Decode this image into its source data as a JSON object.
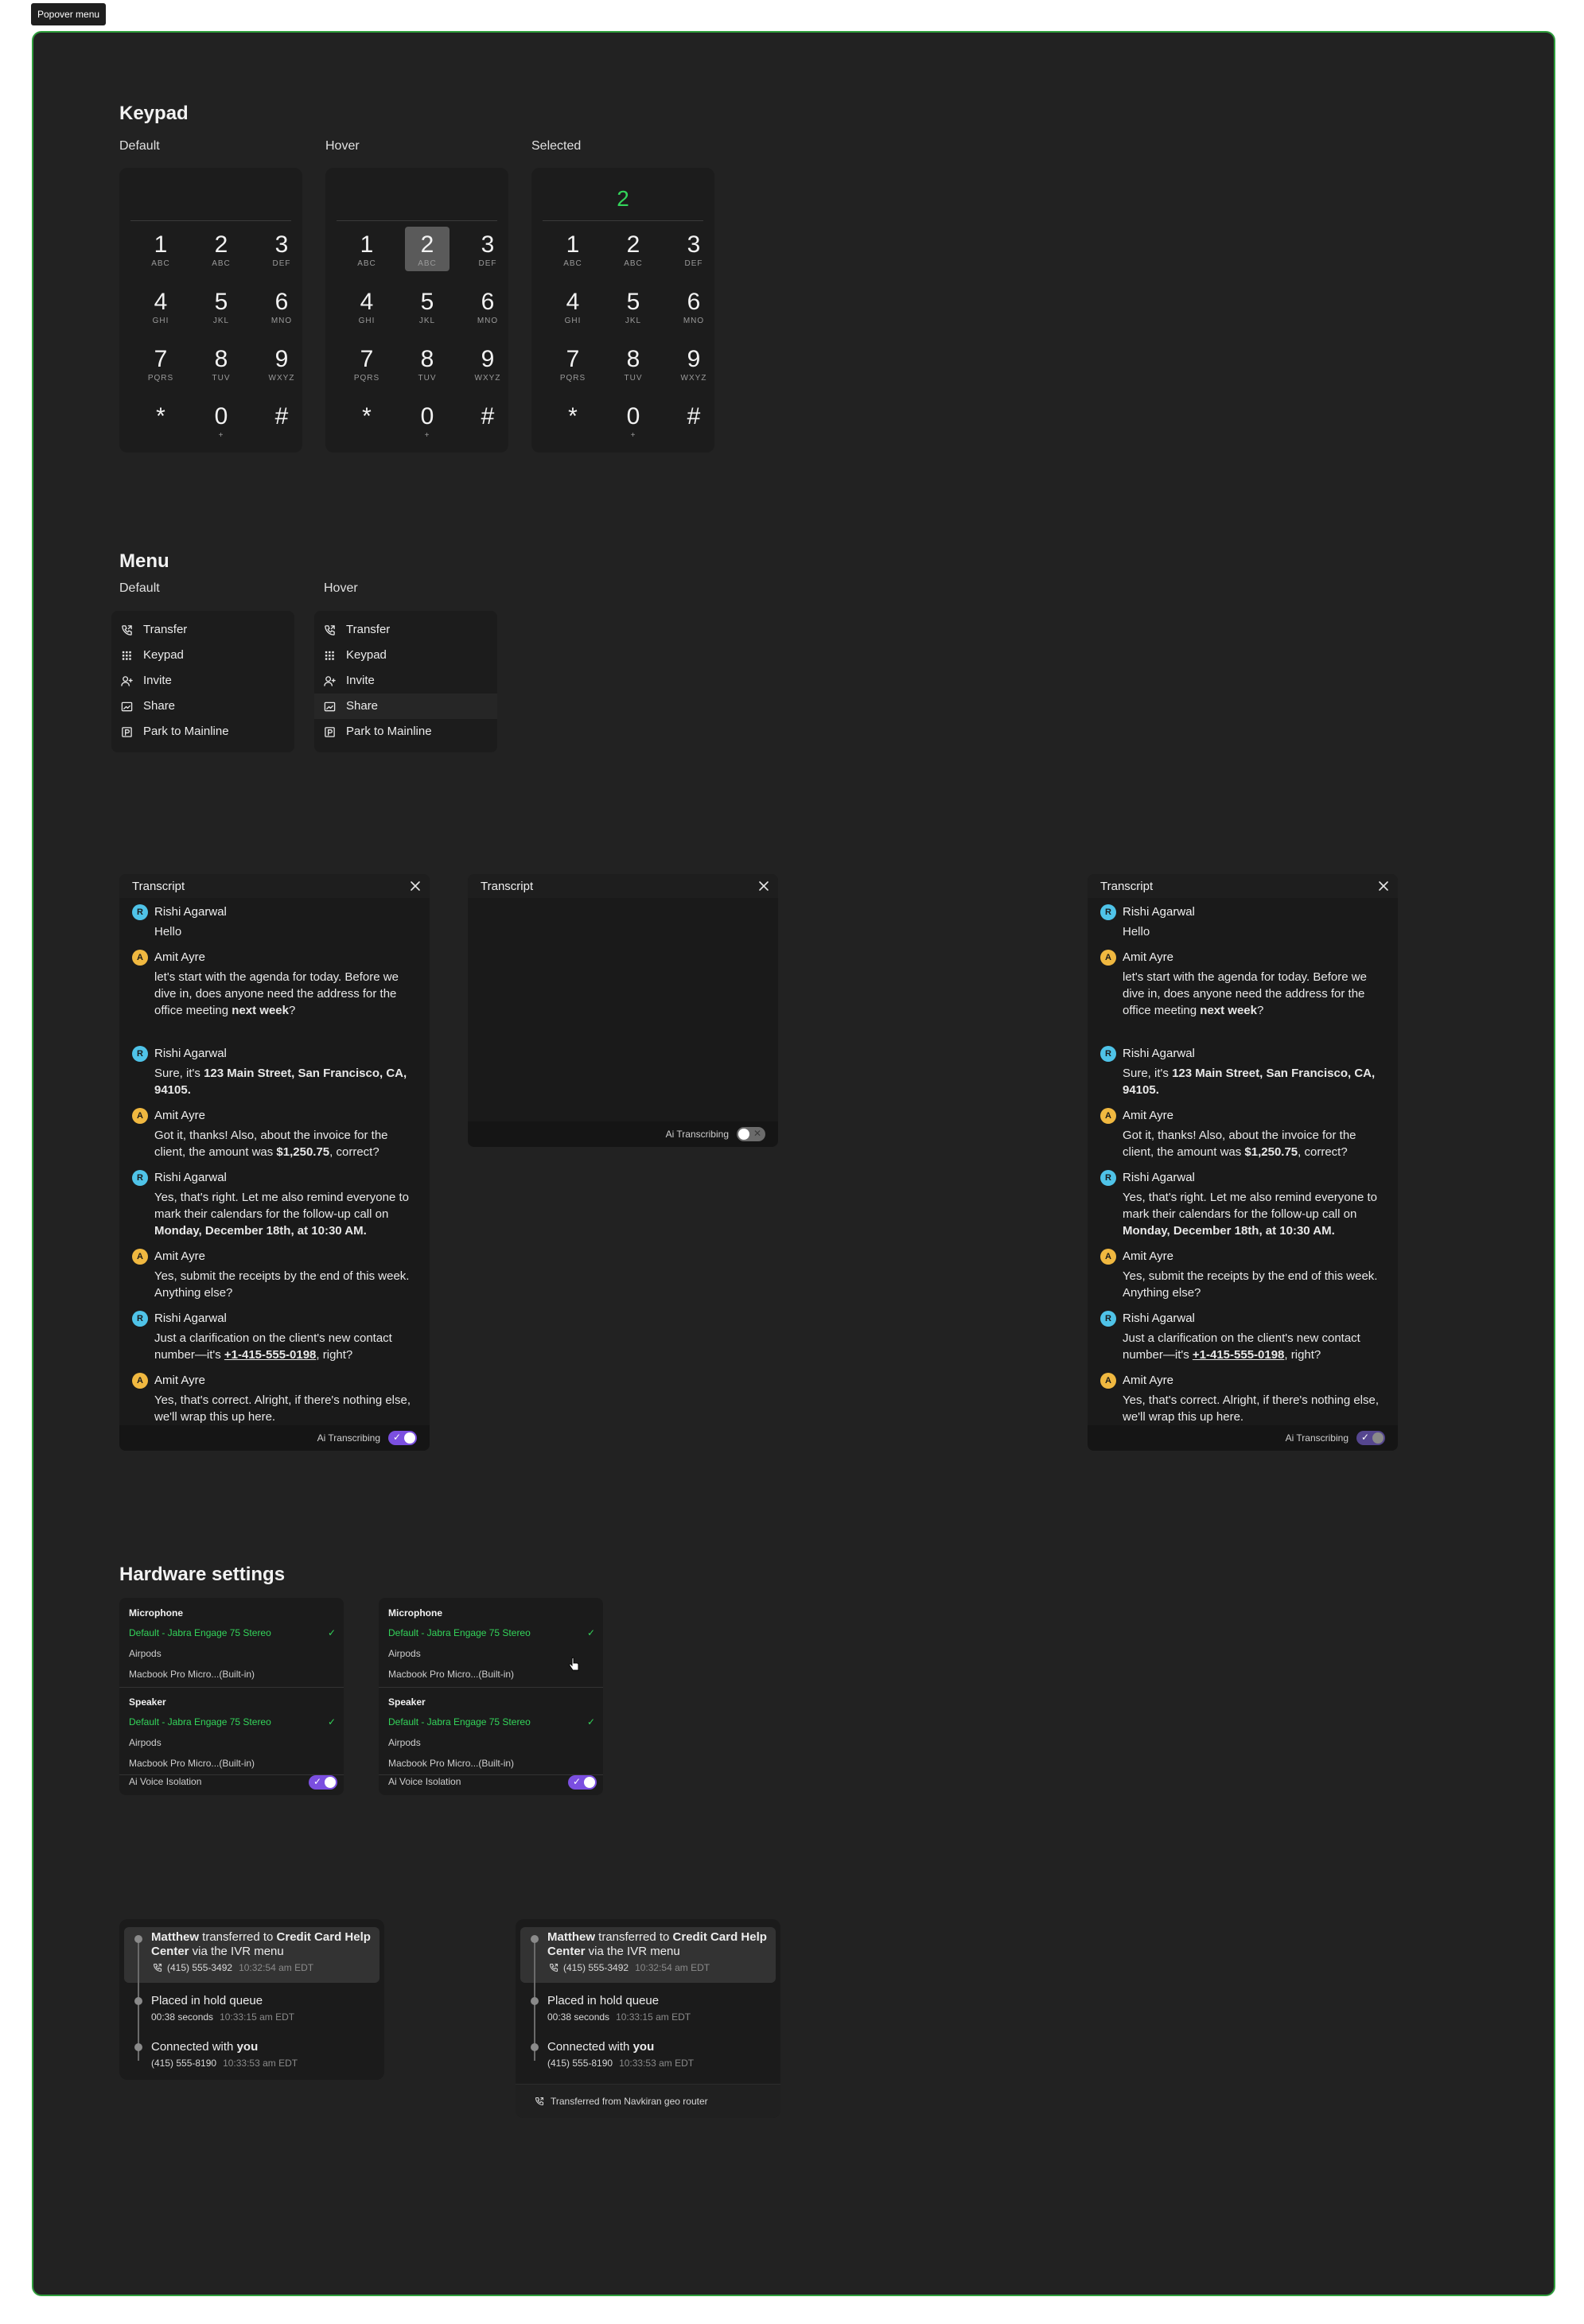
{
  "tag": "Popover menu",
  "keypad": {
    "title": "Keypad",
    "states": [
      "Default",
      "Hover",
      "Selected"
    ],
    "selected_value": "2",
    "keys": [
      {
        "digit": "1",
        "letters": "ABC"
      },
      {
        "digit": "2",
        "letters": "ABC"
      },
      {
        "digit": "3",
        "letters": "DEF"
      },
      {
        "digit": "4",
        "letters": "GHI"
      },
      {
        "digit": "5",
        "letters": "JKL"
      },
      {
        "digit": "6",
        "letters": "MNO"
      },
      {
        "digit": "7",
        "letters": "PQRS"
      },
      {
        "digit": "8",
        "letters": "TUV"
      },
      {
        "digit": "9",
        "letters": "WXYZ"
      },
      {
        "digit": "*",
        "letters": ""
      },
      {
        "digit": "0",
        "letters": "+"
      },
      {
        "digit": "#",
        "letters": ""
      }
    ]
  },
  "menu": {
    "title": "Menu",
    "states": [
      "Default",
      "Hover"
    ],
    "items": [
      {
        "label": "Transfer",
        "icon": "phone-transfer-icon"
      },
      {
        "label": "Keypad",
        "icon": "keypad-grid-icon"
      },
      {
        "label": "Invite",
        "icon": "user-plus-icon"
      },
      {
        "label": "Share",
        "icon": "share-screen-icon"
      },
      {
        "label": "Park to Mainline",
        "icon": "park-icon"
      }
    ]
  },
  "transcript": {
    "title": "Transcript",
    "footer_label": "Ai Transcribing",
    "messages": [
      {
        "initial": "R",
        "name": "Rishi Agarwal",
        "html": "Hello"
      },
      {
        "initial": "A",
        "name": "Amit Ayre",
        "html": " let's start with the agenda for today. Before we dive in, does anyone need the address for the office meeting <b>next week</b>?"
      },
      {
        "initial": "R",
        "name": "Rishi Agarwal",
        "html": "Sure, it's <b>123 Main Street, San Francisco, CA, 94105.</b>"
      },
      {
        "initial": "A",
        "name": "Amit Ayre",
        "html": "Got it, thanks! Also, about the invoice for the client, the amount was <b>$1,250.75</b>, correct?"
      },
      {
        "initial": "R",
        "name": "Rishi Agarwal",
        "html": "Yes, that's right. Let me also remind everyone to mark their calendars for the follow-up call on <b>Monday, December 18th, at 10:30 AM.</b>"
      },
      {
        "initial": "A",
        "name": "Amit Ayre",
        "html": "Yes, submit the receipts by the end of this week. Anything else?"
      },
      {
        "initial": "R",
        "name": "Rishi Agarwal",
        "html": "Just a clarification on the client's new contact number—it's <u>+1-415-555-0198</u>, right?"
      },
      {
        "initial": "A",
        "name": "Amit Ayre",
        "html": "Yes, that's correct. Alright, if there's nothing else, we'll wrap this up here."
      }
    ]
  },
  "hardware": {
    "title": "Hardware settings",
    "microphone_label": "Microphone",
    "speaker_label": "Speaker",
    "options": [
      "Default - Jabra Engage 75 Stereo",
      "Airpods",
      "Macbook Pro Micro...(Built-in)"
    ],
    "voice_isolation_label": "Ai Voice Isolation"
  },
  "call_history": {
    "event1": {
      "actor": "Matthew",
      "verb": " transferred to ",
      "target": "Credit Card Help Center",
      "suffix": " via the IVR menu",
      "phone": "(415) 555-3492",
      "time": "10:32:54 am EDT"
    },
    "event2": {
      "title": "Placed in hold queue",
      "duration": "00:38 seconds",
      "time": "10:33:15 am EDT"
    },
    "event3": {
      "prefix": "Connected with ",
      "who": "you",
      "phone": "(415) 555-8190",
      "time": "10:33:53 am EDT"
    },
    "footer": "Transferred from Navkiran geo router"
  },
  "colors": {
    "frame": "#222222",
    "border": "#2f9e3c",
    "accent_green": "#33d45a",
    "toggle_purple": "#7b4fe0"
  }
}
